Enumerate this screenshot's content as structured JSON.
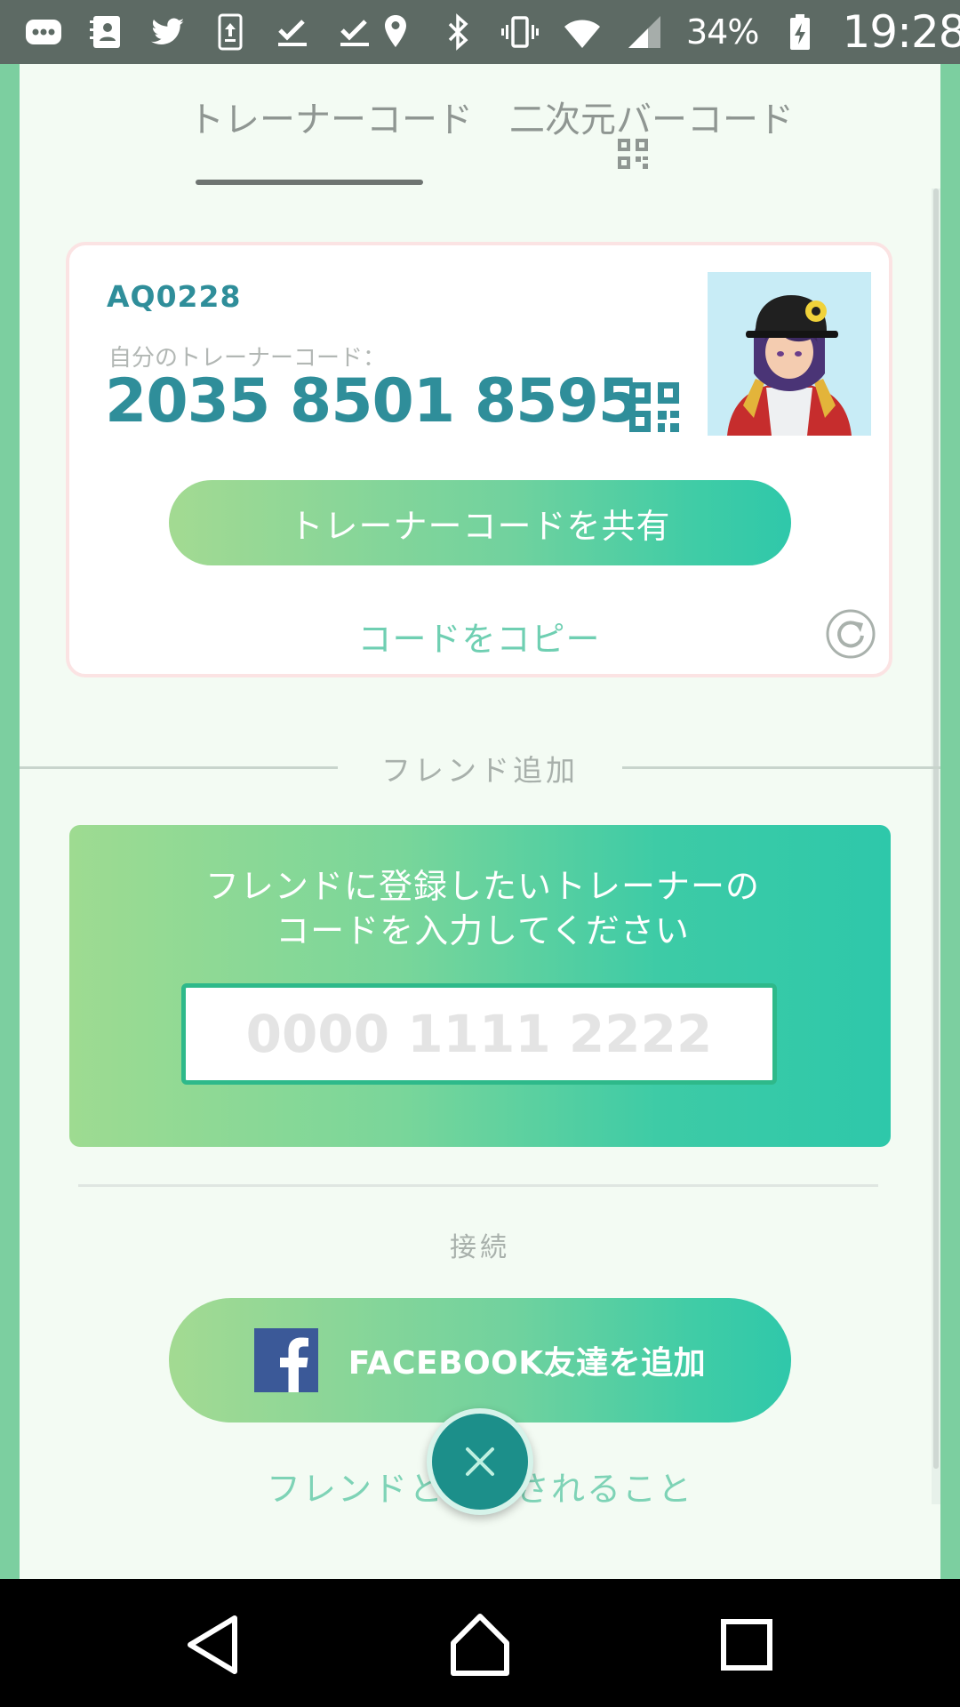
{
  "status_bar": {
    "battery_percent": "34%",
    "time": "19:28",
    "left_icons": [
      "more-notifications-icon",
      "contacts-icon",
      "twitter-icon",
      "upload-icon",
      "download-done-icon",
      "download-done-icon"
    ],
    "right_icons": [
      "location-icon",
      "bluetooth-icon",
      "vibrate-icon",
      "wifi-icon",
      "signal-icon",
      "battery-charging-icon"
    ]
  },
  "tabs": {
    "trainer_code": "トレーナーコード",
    "qr_code": "二次元バーコード",
    "active": "trainer_code"
  },
  "trainer_card": {
    "trainer_name": "AQ0228",
    "code_label": "自分のトレーナーコード：",
    "code_value": "2035 8501 8595",
    "share_button": "トレーナーコードを共有",
    "copy_link": "コードをコピー"
  },
  "friend_add": {
    "section_label": "フレンド追加",
    "instruction": "フレンドに登録したいトレーナーのコードを入力してください",
    "input_placeholder": "0000 1111 2222"
  },
  "connect": {
    "section_label": "接続",
    "facebook_button": "FACEBOOK友達を追加",
    "bottom_text": "フレンドと　　されること"
  },
  "colors": {
    "accent_teal": "#2f8e9a",
    "gradient_start": "#a3da92",
    "gradient_end": "#2fc8aa",
    "close_button": "#1c8f8a",
    "facebook_blue": "#3b5998"
  }
}
